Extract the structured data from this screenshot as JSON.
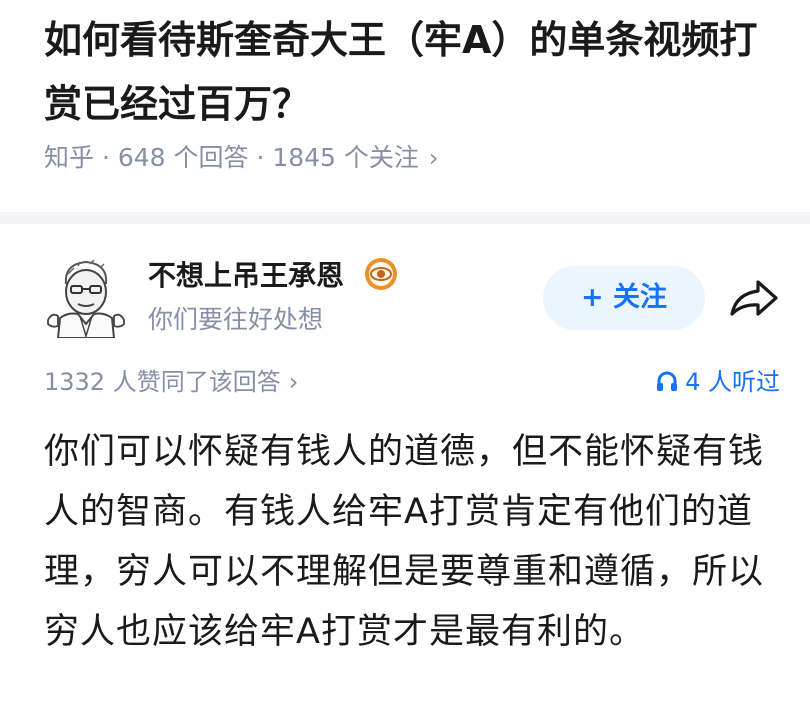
{
  "question": {
    "title": "如何看待斯奎奇大王（牢A）的单条视频打赏已经过百万？",
    "meta": "知乎 · 648 个回答 · 1845 个关注",
    "meta_chevron": "›"
  },
  "answer": {
    "author": {
      "name": "不想上吊王承恩",
      "bio": "你们要往好处想",
      "avatar_icon": "sketch-portrait-avatar",
      "badge_icon": "eye-badge-icon"
    },
    "follow_label": "+ 关注",
    "share_icon": "share-arrow-icon",
    "vote_text": "1332 人赞同了该回答",
    "vote_chevron": "›",
    "listen_icon": "headphone-icon",
    "listen_text": "4 人听过",
    "content": "你们可以怀疑有钱人的道德，但不能怀疑有钱人的智商。有钱人给牢A打赏肯定有他们的道理，穷人可以不理解但是要尊重和遵循，所以穷人也应该给牢A打赏才是最有利的。"
  },
  "colors": {
    "text_primary": "#1a1a1a",
    "text_secondary": "#8590a6",
    "accent_blue": "#1772f6",
    "follow_bg": "#ebf5ff",
    "divider": "#f4f4f6",
    "badge_orange": "#e8912d"
  }
}
